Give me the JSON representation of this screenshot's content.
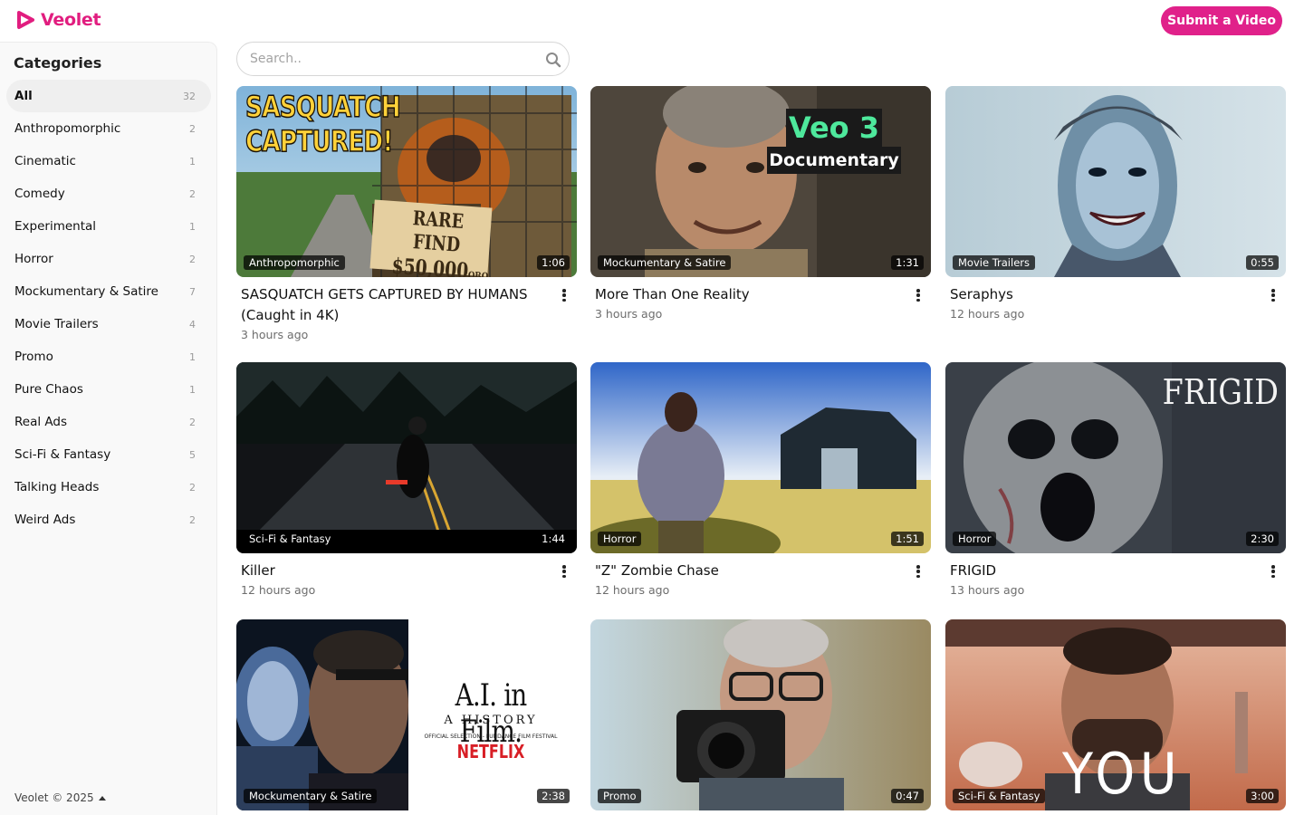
{
  "brand": {
    "name": "Veolet",
    "color": "#e11d7f"
  },
  "header": {
    "submit_label": "Submit a Video"
  },
  "search": {
    "placeholder": "Search.."
  },
  "sidebar": {
    "title": "Categories",
    "items": [
      {
        "label": "All",
        "count": "32",
        "active": true
      },
      {
        "label": "Anthropomorphic",
        "count": "2"
      },
      {
        "label": "Cinematic",
        "count": "1"
      },
      {
        "label": "Comedy",
        "count": "2"
      },
      {
        "label": "Experimental",
        "count": "1"
      },
      {
        "label": "Horror",
        "count": "2"
      },
      {
        "label": "Mockumentary & Satire",
        "count": "7"
      },
      {
        "label": "Movie Trailers",
        "count": "4"
      },
      {
        "label": "Promo",
        "count": "1"
      },
      {
        "label": "Pure Chaos",
        "count": "1"
      },
      {
        "label": "Real Ads",
        "count": "2"
      },
      {
        "label": "Sci-Fi & Fantasy",
        "count": "5"
      },
      {
        "label": "Talking Heads",
        "count": "2"
      },
      {
        "label": "Weird Ads",
        "count": "2"
      }
    ],
    "footer": "Veolet © 2025"
  },
  "videos": [
    {
      "title": "SASQUATCH GETS CAPTURED BY HUMANS (Caught in 4K)",
      "time": "3 hours ago",
      "category": "Anthropomorphic",
      "duration": "1:06",
      "thumb_text": [
        "SASQUATCH",
        "CAPTURED!",
        "RARE FIND",
        "$50,000",
        "OBO"
      ]
    },
    {
      "title": "More Than One Reality",
      "time": "3 hours ago",
      "category": "Mockumentary & Satire",
      "duration": "1:31",
      "thumb_text": [
        "Veo 3",
        "Documentary"
      ]
    },
    {
      "title": "Seraphys",
      "time": "12 hours ago",
      "category": "Movie Trailers",
      "duration": "0:55"
    },
    {
      "title": "Killer",
      "time": "12 hours ago",
      "category": "Sci-Fi & Fantasy",
      "duration": "1:44"
    },
    {
      "title": "\"Z\" Zombie Chase",
      "time": "12 hours ago",
      "category": "Horror",
      "duration": "1:51"
    },
    {
      "title": "FRIGID",
      "time": "13 hours ago",
      "category": "Horror",
      "duration": "2:30",
      "thumb_text": [
        "FRIGID"
      ]
    },
    {
      "title": "",
      "time": "",
      "category": "Mockumentary & Satire",
      "duration": "2:38",
      "thumb_text": [
        "A.I. in Film.",
        "A HISTORY",
        "OFFICIAL SELECTION - FUNDANCE FILM FESTIVAL",
        "NETFLIX"
      ]
    },
    {
      "title": "",
      "time": "",
      "category": "Promo",
      "duration": "0:47"
    },
    {
      "title": "",
      "time": "",
      "category": "Sci-Fi & Fantasy",
      "duration": "3:00",
      "thumb_text": [
        "YOU"
      ]
    }
  ]
}
